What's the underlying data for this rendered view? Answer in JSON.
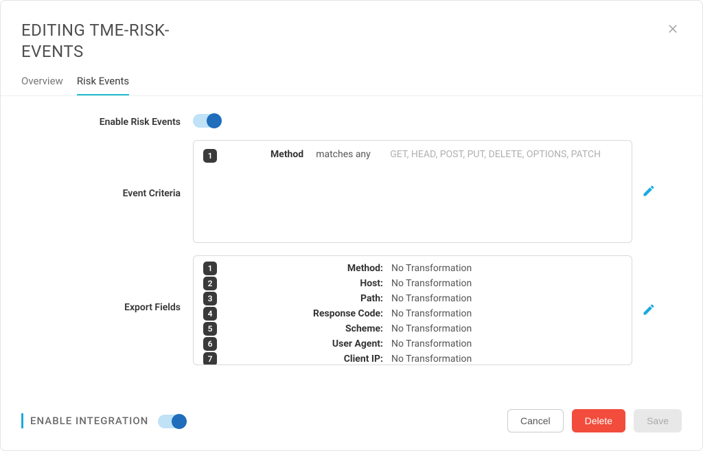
{
  "header": {
    "title": "EDITING TME-RISK-EVENTS"
  },
  "tabs": [
    {
      "id": "overview",
      "label": "Overview",
      "active": false
    },
    {
      "id": "risk-events",
      "label": "Risk Events",
      "active": true
    }
  ],
  "form": {
    "enable_risk_events": {
      "label": "Enable Risk Events",
      "value": true
    },
    "event_criteria": {
      "label": "Event Criteria",
      "rules": [
        {
          "n": "1",
          "field": "Method",
          "op": "matches any",
          "value": "GET, HEAD, POST, PUT, DELETE, OPTIONS, PATCH"
        }
      ]
    },
    "export_fields": {
      "label": "Export Fields",
      "fields": [
        {
          "n": "1",
          "name": "Method:",
          "transform": "No Transformation"
        },
        {
          "n": "2",
          "name": "Host:",
          "transform": "No Transformation"
        },
        {
          "n": "3",
          "name": "Path:",
          "transform": "No Transformation"
        },
        {
          "n": "4",
          "name": "Response Code:",
          "transform": "No Transformation"
        },
        {
          "n": "5",
          "name": "Scheme:",
          "transform": "No Transformation"
        },
        {
          "n": "6",
          "name": "User Agent:",
          "transform": "No Transformation"
        },
        {
          "n": "7",
          "name": "Client IP:",
          "transform": "No Transformation"
        }
      ]
    }
  },
  "footer": {
    "enable_integration": {
      "label": "ENABLE INTEGRATION",
      "value": true
    },
    "buttons": {
      "cancel": "Cancel",
      "delete": "Delete",
      "save": "Save"
    }
  },
  "colors": {
    "accent": "#1aa9e0",
    "toggle_knob": "#1f6dbb",
    "danger": "#f24c3d"
  }
}
